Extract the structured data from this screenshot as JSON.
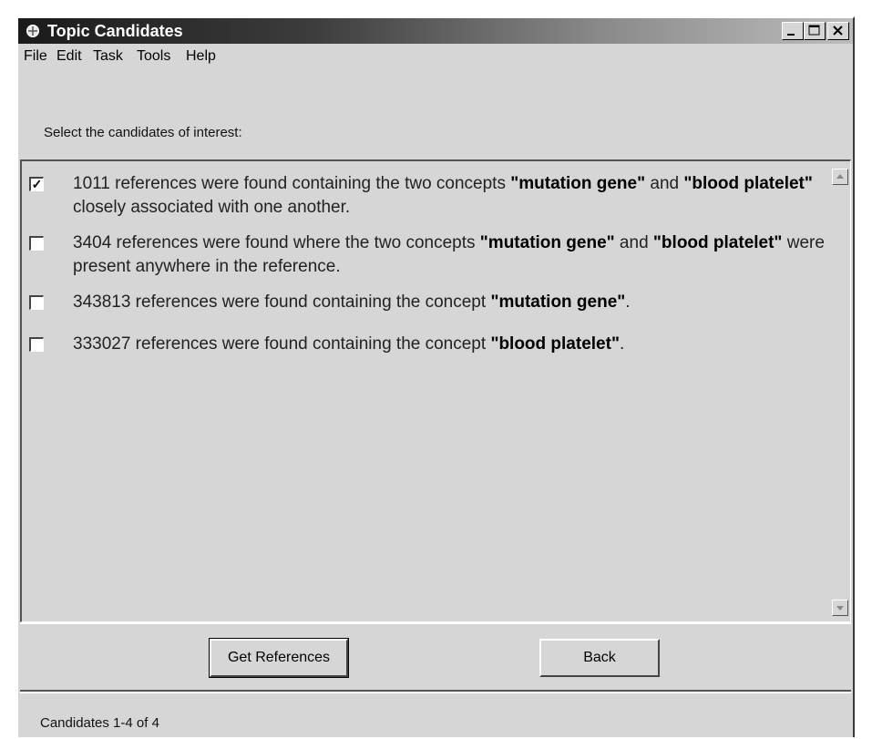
{
  "window": {
    "title": "Topic Candidates"
  },
  "menu": [
    {
      "label": "File"
    },
    {
      "label": "Edit"
    },
    {
      "label": "Task"
    },
    {
      "label": "Tools"
    },
    {
      "label": "Help"
    }
  ],
  "instruction": "Select the candidates of interest:",
  "candidates": [
    {
      "checked": true,
      "count": "1011",
      "text1": " references were found containing the two concepts ",
      "term1": "\"mutation gene\"",
      "text2": " and ",
      "term2": "\"blood platelet\"",
      "text3": " closely associated with one another."
    },
    {
      "checked": false,
      "count": "3404",
      "text1": " references were found where the two concepts ",
      "term1": "\"mutation gene\"",
      "text2": " and ",
      "term2": "\"blood platelet\"",
      "text3": " were present anywhere in the reference."
    },
    {
      "checked": false,
      "count": "343813",
      "text1": " references were found containing the concept ",
      "term1": "\"mutation gene\"",
      "text3": "."
    },
    {
      "checked": false,
      "count": "333027",
      "text1": " references were found containing the concept ",
      "term1": "\"blood platelet\"",
      "text3": "."
    }
  ],
  "buttons": {
    "get_references": "Get References",
    "back": "Back"
  },
  "status": "Candidates 1-4 of 4",
  "colors": {
    "window_bg": "#d6d6d6",
    "titlebar_dark": "#1a1a1a",
    "titlebar_light": "#bdbdbd"
  },
  "icons": {
    "app": "app-icon",
    "minimize": "minimize-icon",
    "maximize": "maximize-icon",
    "close": "close-icon"
  }
}
